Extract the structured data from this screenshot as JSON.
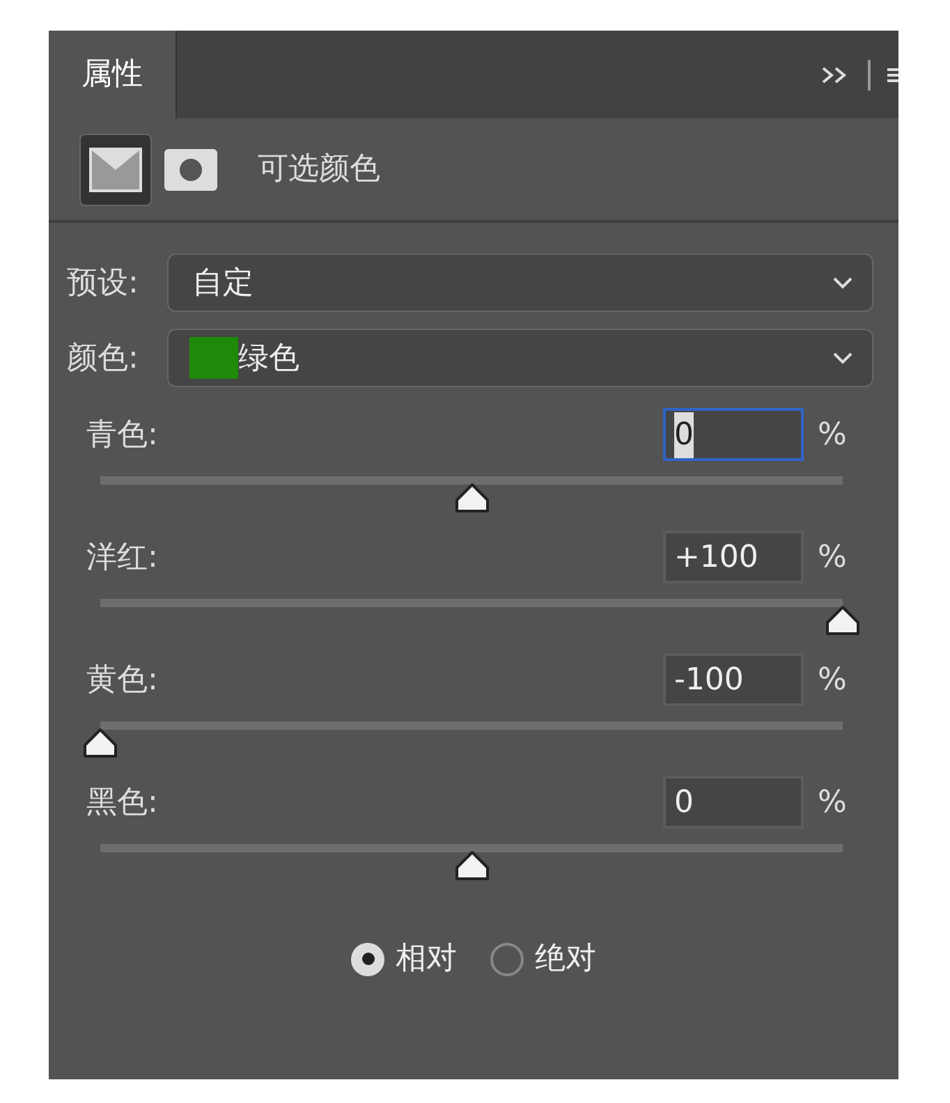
{
  "tabs": [
    {
      "label": "属性",
      "selected": true
    }
  ],
  "header": {
    "title": "可选颜色",
    "modes": [
      {
        "kind": "adjustment",
        "selected": true
      },
      {
        "kind": "mask",
        "selected": false
      }
    ]
  },
  "preset": {
    "label": "预设:",
    "value": "自定"
  },
  "colors": {
    "label": "颜色:",
    "value": "绿色",
    "color": "#1f8a0a"
  },
  "sliders": [
    {
      "label": "青色:",
      "value": "0",
      "unit": "%",
      "level": 0.5,
      "focused": true
    },
    {
      "label": "洋红:",
      "value": "+100",
      "unit": "%",
      "level": 1,
      "focused": false
    },
    {
      "label": "黄色:",
      "value": "-100",
      "unit": "%",
      "level": 0,
      "focused": false
    },
    {
      "label": "黑色:",
      "value": "0",
      "unit": "%",
      "level": 0.5,
      "focused": false
    }
  ],
  "method": [
    {
      "label": "相对",
      "selected": true
    },
    {
      "label": "绝对",
      "selected": false
    }
  ]
}
